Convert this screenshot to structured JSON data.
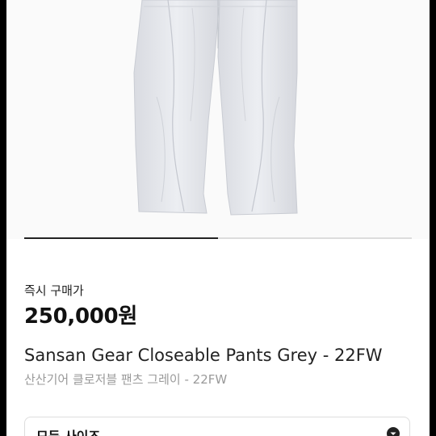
{
  "product": {
    "image_icon": "grey-pants-product-photo",
    "gallery_progress": 0.5
  },
  "purchase": {
    "instant_buy_label": "즉시 구매가",
    "price": "250,000원"
  },
  "title": {
    "english": "Sansan Gear Closeable Pants Grey - 22FW",
    "korean": "산산기어 클로저블 팬츠 그레이 - 22FW"
  },
  "size_select": {
    "value": "모든 사이즈",
    "icon": "chevron-down-icon"
  },
  "colors": {
    "pants": "#e6e7ec",
    "text": "#111111",
    "muted": "#9a9a9a"
  }
}
